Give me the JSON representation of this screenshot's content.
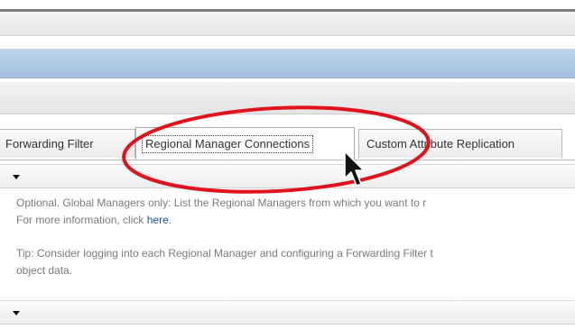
{
  "tabs": [
    {
      "label": "Forwarding Filter"
    },
    {
      "label": "Regional Manager Connections"
    },
    {
      "label": "Custom Attribute Replication"
    }
  ],
  "description": {
    "line1": "Optional. Global Managers only: List the Regional Managers from which you want to r",
    "line2_prefix": "For more information, click",
    "link_text": "here",
    "line2_suffix": ".",
    "tip_line1": "Tip: Consider logging into each Regional Manager and configuring a Forwarding Filter t",
    "tip_line2": "object data."
  },
  "colors": {
    "highlight": "#e0121b",
    "link": "#1f4fb5",
    "header_blue": "#a3bfe0"
  },
  "icons": [
    "chevron-down-icon",
    "mouse-pointer-icon"
  ]
}
